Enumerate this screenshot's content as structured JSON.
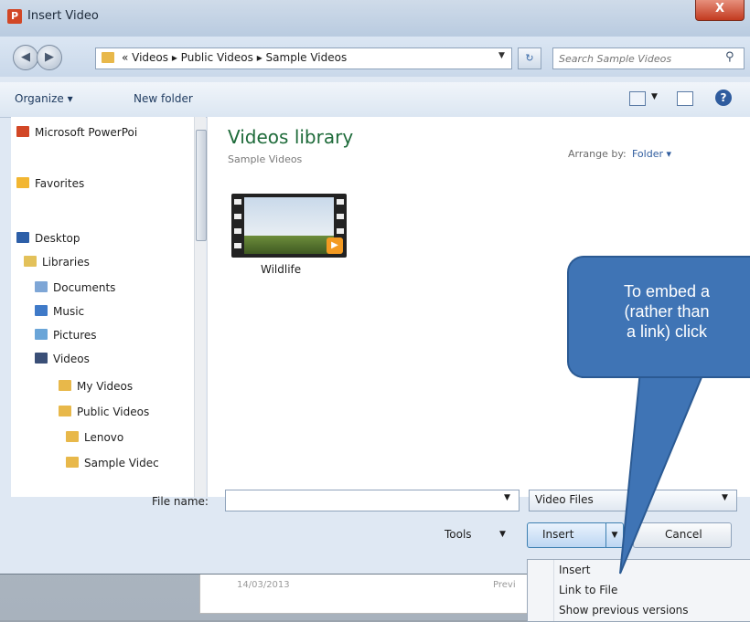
{
  "dialog": {
    "title": "Insert Video",
    "close_label": "X"
  },
  "address": {
    "path": "« Videos ▸ Public Videos ▸ Sample Videos",
    "search_placeholder": "Search Sample Videos"
  },
  "toolbar": {
    "organize_label": "Organize ▾",
    "new_folder_label": "New folder"
  },
  "nav": {
    "items": [
      {
        "label": "Microsoft PowerPoi",
        "icon": "powerpoint-icon"
      },
      {
        "label": "Favorites",
        "icon": "star-icon"
      },
      {
        "label": "Desktop",
        "icon": "desktop-icon"
      },
      {
        "label": "Libraries",
        "icon": "library-icon"
      },
      {
        "label": "Documents",
        "icon": "documents-icon"
      },
      {
        "label": "Music",
        "icon": "music-icon"
      },
      {
        "label": "Pictures",
        "icon": "pictures-icon"
      },
      {
        "label": "Videos",
        "icon": "videos-icon"
      },
      {
        "label": "My Videos",
        "icon": "folder-icon"
      },
      {
        "label": "Public Videos",
        "icon": "folder-icon"
      },
      {
        "label": "Lenovo",
        "icon": "folder-icon"
      },
      {
        "label": "Sample Videc",
        "icon": "folder-icon"
      }
    ]
  },
  "content": {
    "library_title": "Videos library",
    "library_subtitle": "Sample Videos",
    "arrange_by_label": "Arrange by:",
    "arrange_by_value": "Folder ▾",
    "files": [
      {
        "label": "Wildlife"
      }
    ]
  },
  "footer": {
    "file_name_label": "File name:",
    "file_name_value": "",
    "file_type_value": "Video Files",
    "tools_label": "Tools",
    "insert_label": "Insert",
    "cancel_label": "Cancel"
  },
  "insert_menu": {
    "items": [
      "Insert",
      "Link to File",
      "Show previous versions"
    ]
  },
  "callout": {
    "lines": [
      "To embed a",
      "(rather than",
      "a link) click"
    ],
    "color": "#3f74b5"
  },
  "background_doc": {
    "date": "14/03/2013",
    "col2": "Previ"
  }
}
